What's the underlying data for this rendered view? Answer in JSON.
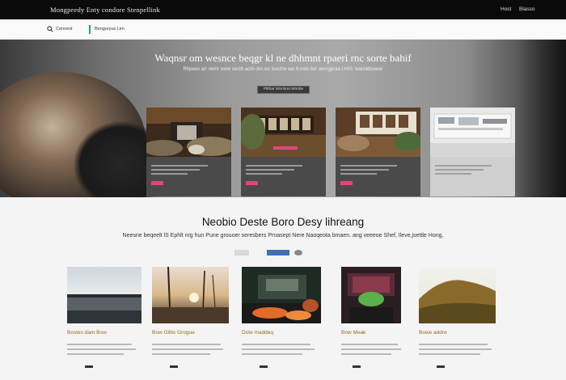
{
  "topbar": {
    "brand": "Mongpeedy Enty condore Stenpellink",
    "nav_items": [
      "Host",
      "Blasso"
    ]
  },
  "subbar": {
    "search_label": "Cennest",
    "breadcrumb": "Bengoryus Lim"
  },
  "hero": {
    "title": "Waqnsr om wesnce beqgr kl ne dhhmnt rpaeri rnc sorte bahif",
    "subtitle": "Rhpeex arr ownr vwre secth acrb ckn.wc bocthe oar fr.rreb bor avrngpraa LHIS. warrddsweer",
    "button_label": "Pltthar Wonhoa  Wonbe"
  },
  "section": {
    "title": "Neobio Deste Boro Desy lihreang",
    "subtitle": "Neesne beqeelt lS Ephlt nrg hun Pune grouoer seresbers Prnasept Nere Naoqeota bmaen. ang veeeoe Shef, Ileve,jsettle Hong,"
  },
  "gallery": [
    {
      "title": "Bostes dam Bow"
    },
    {
      "title": "Bow Gilbs Grogue"
    },
    {
      "title": "Dote maddeq"
    },
    {
      "title": "Bow Meak"
    },
    {
      "title": "Bowe addre"
    }
  ],
  "colors": {
    "accent_pink": "#e0457b",
    "accent_teal": "#2a9d8f",
    "gallery_title": "#9a6a1b"
  }
}
